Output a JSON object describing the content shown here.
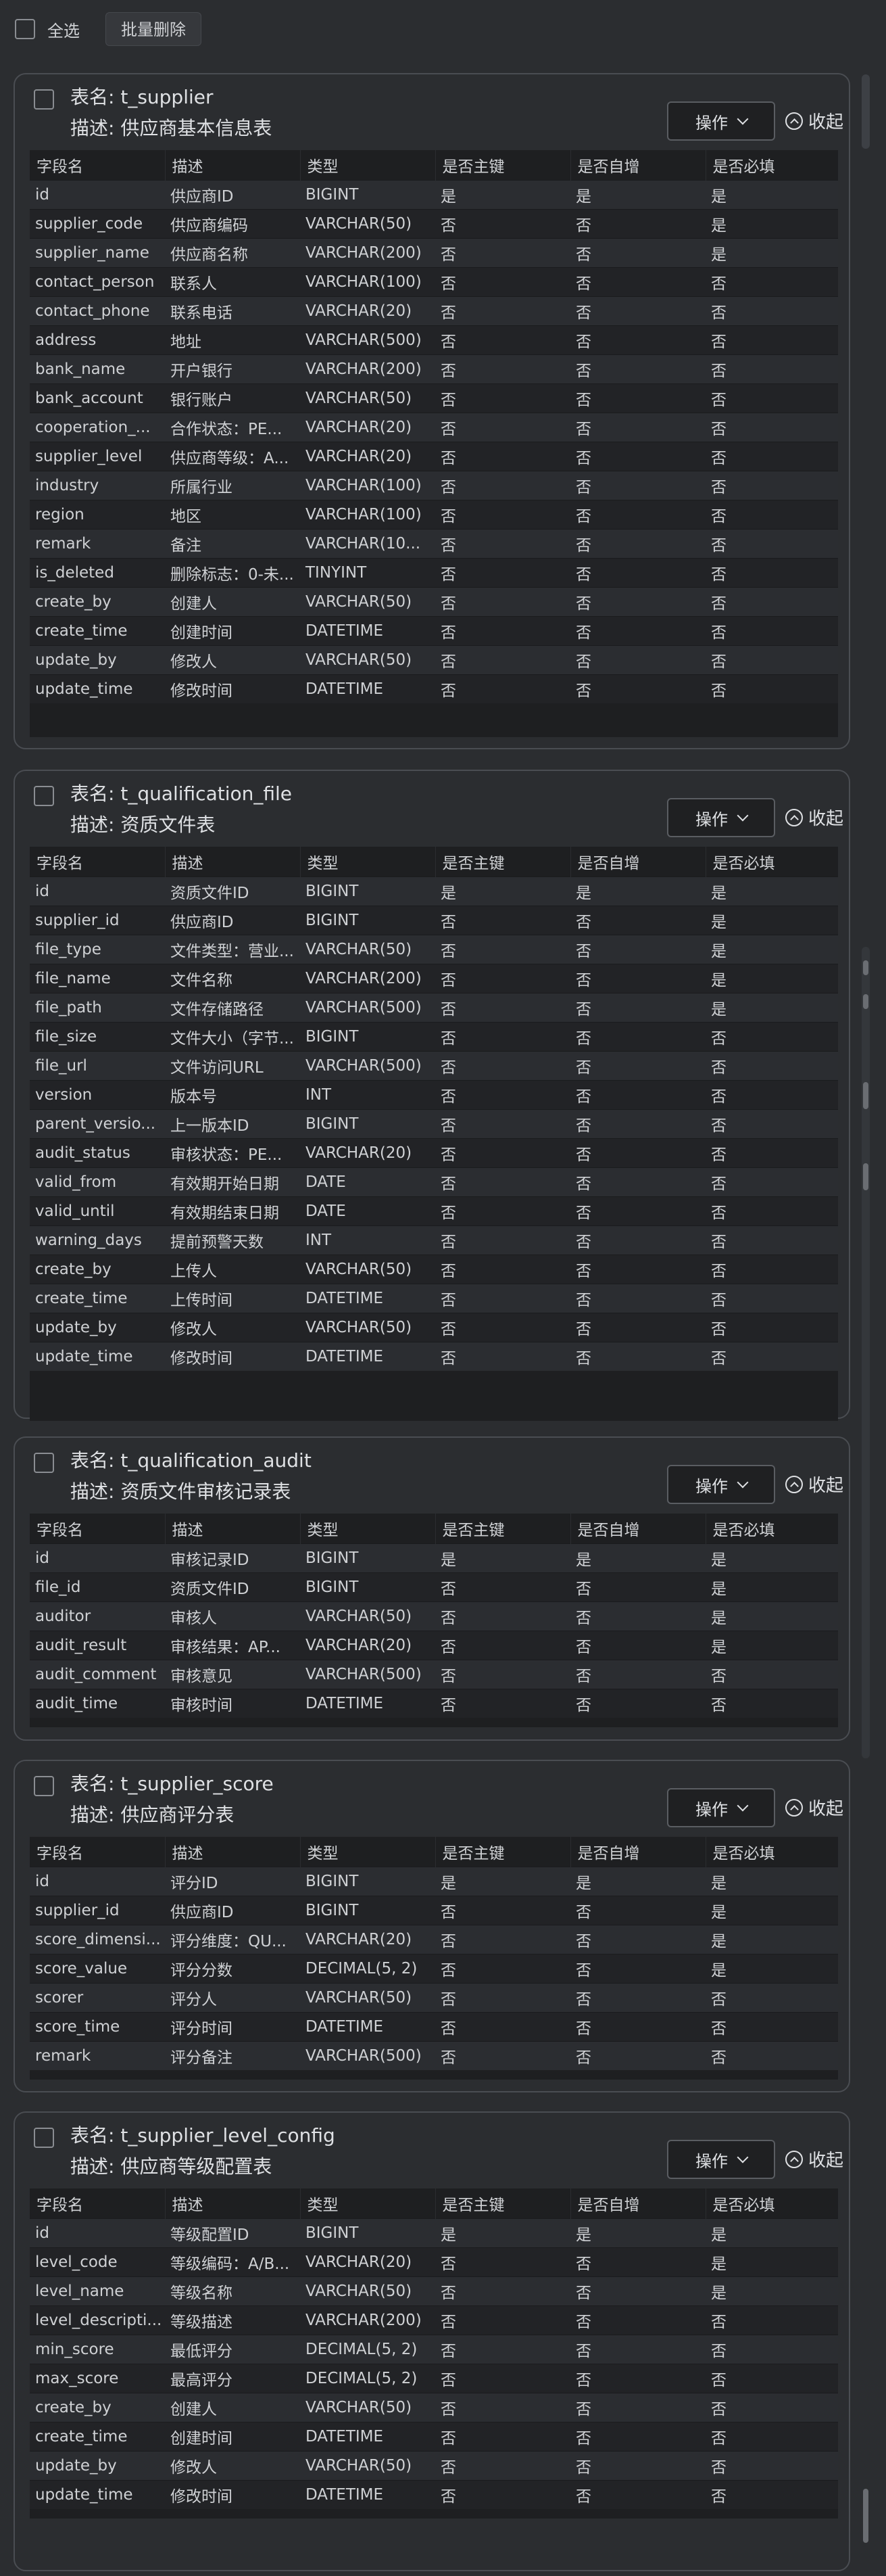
{
  "toolbar": {
    "select_all_label": "全选",
    "batch_delete_label": "批量删除"
  },
  "columns": [
    "字段名",
    "描述",
    "类型",
    "是否主键",
    "是否自增",
    "是否必填"
  ],
  "op_label": "操作",
  "collapse_label": "收起",
  "tables": [
    {
      "name": "表名: t_supplier",
      "desc": "描述: 供应商基本信息表",
      "rows": [
        [
          "id",
          "供应商ID",
          "BIGINT",
          "是",
          "是",
          "是"
        ],
        [
          "supplier_code",
          "供应商编码",
          "VARCHAR(50)",
          "否",
          "否",
          "是"
        ],
        [
          "supplier_name",
          "供应商名称",
          "VARCHAR(200)",
          "否",
          "否",
          "是"
        ],
        [
          "contact_person",
          "联系人",
          "VARCHAR(100)",
          "否",
          "否",
          "否"
        ],
        [
          "contact_phone",
          "联系电话",
          "VARCHAR(20)",
          "否",
          "否",
          "否"
        ],
        [
          "address",
          "地址",
          "VARCHAR(500)",
          "否",
          "否",
          "否"
        ],
        [
          "bank_name",
          "开户银行",
          "VARCHAR(200)",
          "否",
          "否",
          "否"
        ],
        [
          "bank_account",
          "银行账户",
          "VARCHAR(50)",
          "否",
          "否",
          "否"
        ],
        [
          "cooperation_...",
          "合作状态：PE...",
          "VARCHAR(20)",
          "否",
          "否",
          "否"
        ],
        [
          "supplier_level",
          "供应商等级：A...",
          "VARCHAR(20)",
          "否",
          "否",
          "否"
        ],
        [
          "industry",
          "所属行业",
          "VARCHAR(100)",
          "否",
          "否",
          "否"
        ],
        [
          "region",
          "地区",
          "VARCHAR(100)",
          "否",
          "否",
          "否"
        ],
        [
          "remark",
          "备注",
          "VARCHAR(10...",
          "否",
          "否",
          "否"
        ],
        [
          "is_deleted",
          "删除标志：0-未...",
          "TINYINT",
          "否",
          "否",
          "否"
        ],
        [
          "create_by",
          "创建人",
          "VARCHAR(50)",
          "否",
          "否",
          "否"
        ],
        [
          "create_time",
          "创建时间",
          "DATETIME",
          "否",
          "否",
          "否"
        ],
        [
          "update_by",
          "修改人",
          "VARCHAR(50)",
          "否",
          "否",
          "否"
        ],
        [
          "update_time",
          "修改时间",
          "DATETIME",
          "否",
          "否",
          "否"
        ]
      ]
    },
    {
      "name": "表名: t_qualification_file",
      "desc": "描述: 资质文件表",
      "rows": [
        [
          "id",
          "资质文件ID",
          "BIGINT",
          "是",
          "是",
          "是"
        ],
        [
          "supplier_id",
          "供应商ID",
          "BIGINT",
          "否",
          "否",
          "是"
        ],
        [
          "file_type",
          "文件类型：营业...",
          "VARCHAR(50)",
          "否",
          "否",
          "是"
        ],
        [
          "file_name",
          "文件名称",
          "VARCHAR(200)",
          "否",
          "否",
          "是"
        ],
        [
          "file_path",
          "文件存储路径",
          "VARCHAR(500)",
          "否",
          "否",
          "是"
        ],
        [
          "file_size",
          "文件大小（字节...",
          "BIGINT",
          "否",
          "否",
          "否"
        ],
        [
          "file_url",
          "文件访问URL",
          "VARCHAR(500)",
          "否",
          "否",
          "否"
        ],
        [
          "version",
          "版本号",
          "INT",
          "否",
          "否",
          "否"
        ],
        [
          "parent_versio...",
          "上一版本ID",
          "BIGINT",
          "否",
          "否",
          "否"
        ],
        [
          "audit_status",
          "审核状态：PE...",
          "VARCHAR(20)",
          "否",
          "否",
          "否"
        ],
        [
          "valid_from",
          "有效期开始日期",
          "DATE",
          "否",
          "否",
          "否"
        ],
        [
          "valid_until",
          "有效期结束日期",
          "DATE",
          "否",
          "否",
          "否"
        ],
        [
          "warning_days",
          "提前预警天数",
          "INT",
          "否",
          "否",
          "否"
        ],
        [
          "create_by",
          "上传人",
          "VARCHAR(50)",
          "否",
          "否",
          "否"
        ],
        [
          "create_time",
          "上传时间",
          "DATETIME",
          "否",
          "否",
          "否"
        ],
        [
          "update_by",
          "修改人",
          "VARCHAR(50)",
          "否",
          "否",
          "否"
        ],
        [
          "update_time",
          "修改时间",
          "DATETIME",
          "否",
          "否",
          "否"
        ]
      ]
    },
    {
      "name": "表名: t_qualification_audit",
      "desc": "描述: 资质文件审核记录表",
      "rows": [
        [
          "id",
          "审核记录ID",
          "BIGINT",
          "是",
          "是",
          "是"
        ],
        [
          "file_id",
          "资质文件ID",
          "BIGINT",
          "否",
          "否",
          "是"
        ],
        [
          "auditor",
          "审核人",
          "VARCHAR(50)",
          "否",
          "否",
          "是"
        ],
        [
          "audit_result",
          "审核结果：AP...",
          "VARCHAR(20)",
          "否",
          "否",
          "是"
        ],
        [
          "audit_comment",
          "审核意见",
          "VARCHAR(500)",
          "否",
          "否",
          "否"
        ],
        [
          "audit_time",
          "审核时间",
          "DATETIME",
          "否",
          "否",
          "否"
        ]
      ]
    },
    {
      "name": "表名: t_supplier_score",
      "desc": "描述: 供应商评分表",
      "rows": [
        [
          "id",
          "评分ID",
          "BIGINT",
          "是",
          "是",
          "是"
        ],
        [
          "supplier_id",
          "供应商ID",
          "BIGINT",
          "否",
          "否",
          "是"
        ],
        [
          "score_dimensi...",
          "评分维度：QU...",
          "VARCHAR(20)",
          "否",
          "否",
          "是"
        ],
        [
          "score_value",
          "评分分数",
          "DECIMAL(5, 2)",
          "否",
          "否",
          "是"
        ],
        [
          "scorer",
          "评分人",
          "VARCHAR(50)",
          "否",
          "否",
          "否"
        ],
        [
          "score_time",
          "评分时间",
          "DATETIME",
          "否",
          "否",
          "否"
        ],
        [
          "remark",
          "评分备注",
          "VARCHAR(500)",
          "否",
          "否",
          "否"
        ]
      ]
    },
    {
      "name": "表名: t_supplier_level_config",
      "desc": "描述: 供应商等级配置表",
      "rows": [
        [
          "id",
          "等级配置ID",
          "BIGINT",
          "是",
          "是",
          "是"
        ],
        [
          "level_code",
          "等级编码：A/B...",
          "VARCHAR(20)",
          "否",
          "否",
          "是"
        ],
        [
          "level_name",
          "等级名称",
          "VARCHAR(50)",
          "否",
          "否",
          "是"
        ],
        [
          "level_descripti...",
          "等级描述",
          "VARCHAR(200)",
          "否",
          "否",
          "否"
        ],
        [
          "min_score",
          "最低评分",
          "DECIMAL(5, 2)",
          "否",
          "否",
          "否"
        ],
        [
          "max_score",
          "最高评分",
          "DECIMAL(5, 2)",
          "否",
          "否",
          "否"
        ],
        [
          "create_by",
          "创建人",
          "VARCHAR(50)",
          "否",
          "否",
          "否"
        ],
        [
          "create_time",
          "创建时间",
          "DATETIME",
          "否",
          "否",
          "否"
        ],
        [
          "update_by",
          "修改人",
          "VARCHAR(50)",
          "否",
          "否",
          "否"
        ],
        [
          "update_time",
          "修改时间",
          "DATETIME",
          "否",
          "否",
          "否"
        ]
      ]
    }
  ]
}
